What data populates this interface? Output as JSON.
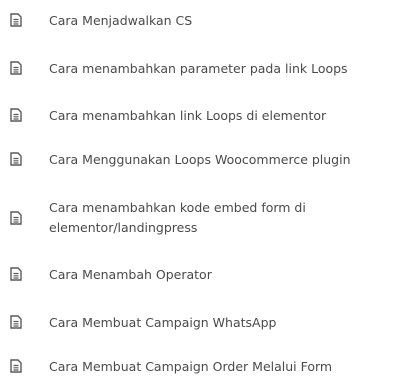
{
  "articles": [
    {
      "label": "Cara Menjadwalkan CS",
      "icon": "document-icon"
    },
    {
      "label": "Cara menambahkan parameter pada link Loops",
      "icon": "document-icon"
    },
    {
      "label": "Cara menambahkan link Loops di elementor",
      "icon": "document-icon"
    },
    {
      "label": "Cara Menggunakan Loops Woocommerce plugin",
      "icon": "document-icon"
    },
    {
      "label": "Cara menambahkan kode embed form di elementor/landingpress",
      "icon": "document-icon"
    },
    {
      "label": "Cara Menambah Operator",
      "icon": "document-icon"
    },
    {
      "label": "Cara Membuat Campaign WhatsApp",
      "icon": "document-icon"
    },
    {
      "label": "Cara Membuat Campaign Order Melalui Form",
      "icon": "document-icon"
    }
  ],
  "colors": {
    "text": "#4a4a4a",
    "icon": "#5a5a5a",
    "background": "#ffffff"
  }
}
